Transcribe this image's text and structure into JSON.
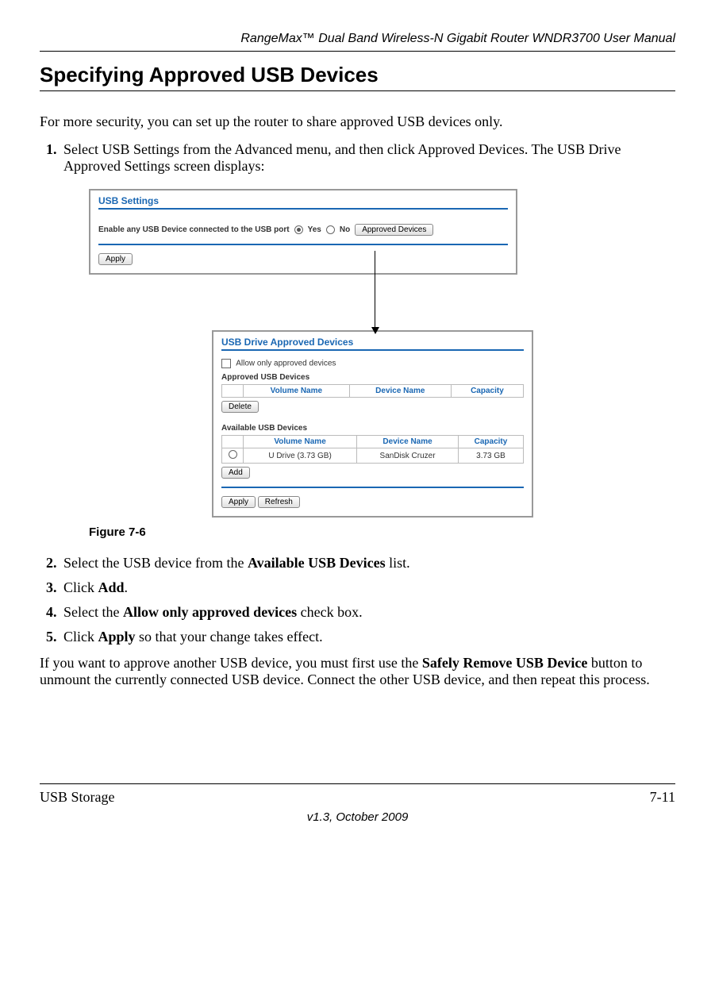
{
  "header": {
    "doc_title": "RangeMax™ Dual Band Wireless-N Gigabit Router WNDR3700 User Manual"
  },
  "section": {
    "title": "Specifying Approved USB Devices",
    "intro": "For more security, you can set up the router to share approved USB devices only.",
    "steps": {
      "s1": "Select USB Settings from the Advanced menu, and then click Approved Devices. The USB Drive Approved Settings screen displays:",
      "s2_a": "Select the USB device from the ",
      "s2_b": "Available USB Devices",
      "s2_c": " list.",
      "s3_a": "Click ",
      "s3_b": "Add",
      "s3_c": ".",
      "s4_a": "Select the ",
      "s4_b": "Allow only approved devices",
      "s4_c": " check box.",
      "s5_a": "Click ",
      "s5_b": "Apply",
      "s5_c": " so that your change takes effect."
    },
    "after_a": "If you want to approve another USB device, you must first use the ",
    "after_b": "Safely Remove USB Device",
    "after_c": " button to unmount the currently connected USB device. Connect the other USB device, and then repeat this process.",
    "figure_caption": "Figure 7-6"
  },
  "screenshot": {
    "panel1": {
      "title": "USB Settings",
      "enable_label": "Enable any USB Device connected to the USB port",
      "yes": "Yes",
      "no": "No",
      "approved_btn": "Approved Devices",
      "apply_btn": "Apply"
    },
    "panel2": {
      "title": "USB Drive Approved Devices",
      "allow_label": "Allow only approved devices",
      "approved_label": "Approved USB Devices",
      "available_label": "Available USB Devices",
      "col_volume": "Volume Name",
      "col_device": "Device Name",
      "col_capacity": "Capacity",
      "row_volume": "U Drive (3.73 GB)",
      "row_device": "SanDisk Cruzer",
      "row_capacity": "3.73 GB",
      "delete_btn": "Delete",
      "add_btn": "Add",
      "apply_btn": "Apply",
      "refresh_btn": "Refresh"
    }
  },
  "footer": {
    "left": "USB Storage",
    "right": "7-11",
    "version": "v1.3, October 2009"
  }
}
